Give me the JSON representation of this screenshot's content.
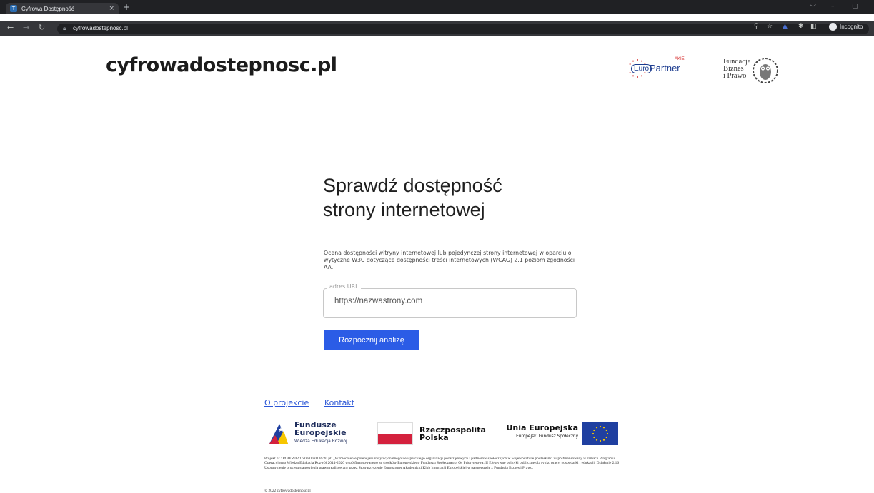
{
  "browser": {
    "tab_title": "Cyfrowa Dostępność",
    "tab_close": "×",
    "new_tab": "+",
    "url": "cyfrowadostepnosc.pl",
    "incognito_label": "Incognito",
    "win_controls": [
      "﹀",
      "–",
      "▢"
    ]
  },
  "header": {
    "site_logo": "cyfrowadostepnosc.pl",
    "partner": {
      "euro": "Euro",
      "name": "Partner",
      "tag": "AKIE"
    },
    "foundation_lines": [
      "Fundacja",
      "Biznes",
      "i Prawo"
    ]
  },
  "hero": {
    "title_line1": "Sprawdź dostępność",
    "title_line2": "strony internetowej",
    "description": "Ocena dostępności witryny internetowej lub pojedynczej strony internetowej w oparciu o wytyczne W3C dotyczące dostępności treści internetowych (WCAG) 2.1 poziom zgodności AA.",
    "url_field": {
      "label": "adres URL",
      "placeholder": "https://nazwastrony.com",
      "value": ""
    },
    "submit_label": "Rozpocznij analizę"
  },
  "footer": {
    "links": [
      "O projekcie",
      "Kontakt"
    ],
    "funds": {
      "fe_line1": "Fundusze",
      "fe_line2": "Europejskie",
      "fe_sub": "Wiedza Edukacja Rozwój",
      "rp_line1": "Rzeczpospolita",
      "rp_line2": "Polska",
      "ue_name": "Unia Europejska",
      "ue_sub": "Europejski Fundusz Społeczny"
    },
    "legal": "Projekt nr : POWR.02.16.00-00-0136/20 pt. „Wzmocnienie potencjału instytucjonalnego i eksperckiego organizacji pozarządowych i partnerów społecznych w województwie podlaskim\" współfinansowany w ramach Programu Operacyjnego Wiedza Edukacja Rozwój 2014-2020 współfinansowanego ze środków Europejskiego Funduszu Społecznego, Oś Priorytetowa: II Efektywne polityki publiczne dla rynku pracy, gospodarki i edukacji, Działanie 2.16 Usprawnienie procesu stanowienia prawa realizowany przez Stowarzyszenie Europartner Akademicki Klub Integracji Europejskiej w partnerstwie z Fundacja Biznes i Prawo.",
    "copyright": "© 2022 cyfrowadostepnosc.pl"
  }
}
